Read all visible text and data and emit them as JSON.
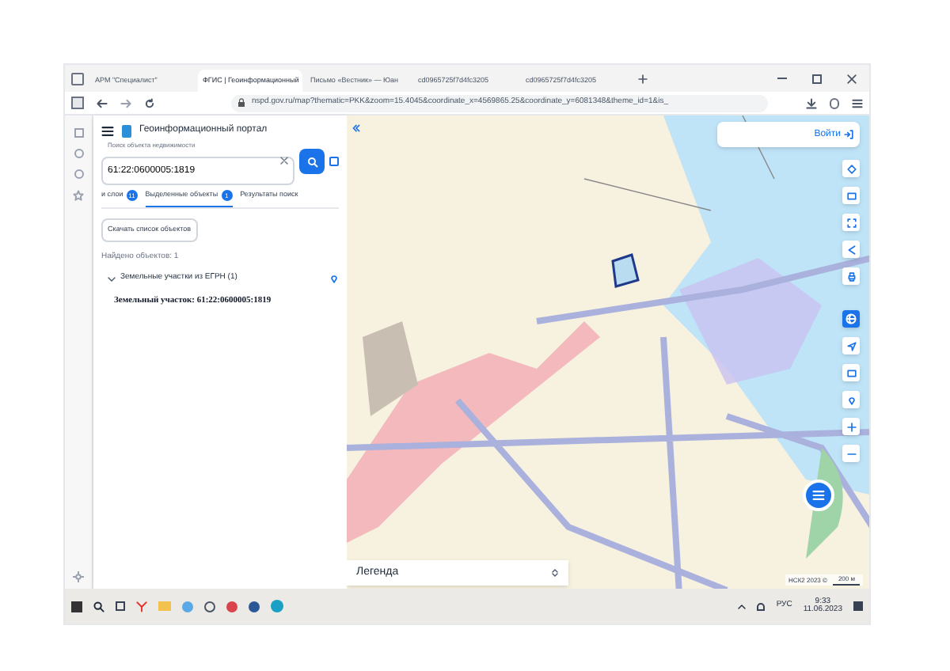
{
  "browser": {
    "tabs": [
      {
        "label": "АРМ \"Специалист\"",
        "selected": false
      },
      {
        "label": "ФГИС | Геоинформационный",
        "selected": true
      },
      {
        "label": "Письмо «Вестник» — Юан",
        "selected": false
      },
      {
        "label": "cd0965725f7d4fc3205",
        "selected": false
      },
      {
        "label": "cd0965725f7d4fc3205",
        "selected": false
      }
    ],
    "url": "nspd.gov.ru/map?thematic=PKK&zoom=15.4045&coordinate_x=4569865.25&coordinate_y=6081348&theme_id=1&is_"
  },
  "panel": {
    "title": "Геоинформационный портал",
    "search": {
      "label": "Поиск объекта недвижимости",
      "value": "61:22:0600005:1819"
    },
    "tabs": [
      {
        "label": "и слои",
        "count": "11",
        "selected": false
      },
      {
        "label": "Выделенные объекты",
        "count": "1",
        "selected": true
      },
      {
        "label": "Результаты поиск",
        "selected": false
      }
    ],
    "download_button": "Скачать список объектов",
    "found": "Найдено объектов: 1",
    "group": {
      "label": "Земельные участки из ЕГРН (1)",
      "expanded": true,
      "items": [
        "Земельный участок: 61:22:0600005:1819"
      ]
    }
  },
  "map": {
    "login": "Войти",
    "legend": "Легенда",
    "attribution": "НСК2 2023 ©",
    "scale": "200 м"
  },
  "taskbar": {
    "language": "РУС",
    "time": "9:33",
    "date": "11.06.2023"
  }
}
